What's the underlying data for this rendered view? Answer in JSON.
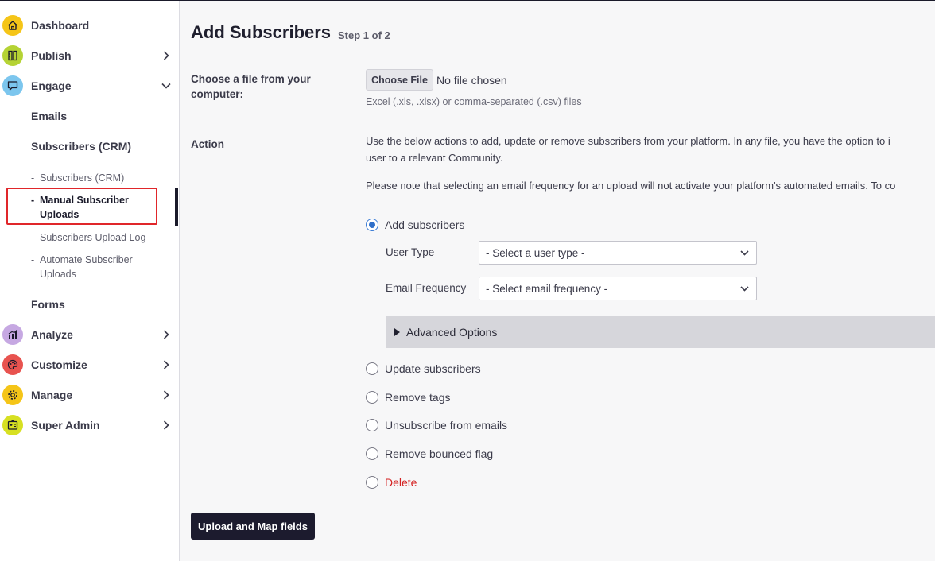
{
  "sidebar": {
    "items": [
      {
        "label": "Dashboard",
        "icon": "home-icon",
        "color": "#f5c518"
      },
      {
        "label": "Publish",
        "icon": "pencil-ruler-icon",
        "color": "#b5d334"
      },
      {
        "label": "Engage",
        "icon": "chat-icon",
        "color": "#7cc6ee"
      },
      {
        "label": "Analyze",
        "icon": "chart-icon",
        "color": "#c6a8e2"
      },
      {
        "label": "Customize",
        "icon": "palette-icon",
        "color": "#e8534f"
      },
      {
        "label": "Manage",
        "icon": "gear-icon",
        "color": "#f5c518"
      },
      {
        "label": "Super Admin",
        "icon": "id-badge-icon",
        "color": "#d7e022"
      }
    ],
    "engage_sub": {
      "emails": "Emails",
      "subscribers": "Subscribers (CRM)",
      "forms": "Forms",
      "subsub": [
        {
          "label": "Subscribers (CRM)"
        },
        {
          "label": "Manual Subscriber Uploads",
          "line1": "Manual Subscriber",
          "line2": "Uploads"
        },
        {
          "label": "Subscribers Upload Log"
        },
        {
          "label": "Automate Subscriber Uploads",
          "line1": "Automate Subscriber",
          "line2": "Uploads"
        }
      ],
      "dash": "-"
    }
  },
  "main": {
    "title": "Add Subscribers",
    "step": "Step 1 of 2",
    "file": {
      "label": "Choose a file from your computer:",
      "button": "Choose File",
      "status": "No file chosen",
      "hint": "Excel (.xls, .xlsx) or comma-separated (.csv) files"
    },
    "action": {
      "label": "Action",
      "para1_line1": "Use the below actions to add, update or remove subscribers from your platform. In any file, you have the option to i",
      "para1_line2": "user to a relevant Community.",
      "para2": "Please note that selecting an email frequency for an upload will not activate your platform's automated emails. To co",
      "options": [
        {
          "label": "Add subscribers",
          "checked": true
        },
        {
          "label": "Update subscribers",
          "checked": false
        },
        {
          "label": "Remove tags",
          "checked": false
        },
        {
          "label": "Unsubscribe from emails",
          "checked": false
        },
        {
          "label": "Remove bounced flag",
          "checked": false
        },
        {
          "label": "Delete",
          "checked": false
        }
      ],
      "user_type": {
        "label": "User Type",
        "value": "- Select a user type -"
      },
      "email_frequency": {
        "label": "Email Frequency",
        "value": "- Select email frequency -"
      },
      "advanced": "Advanced Options"
    },
    "submit": "Upload and Map fields"
  },
  "colors": {
    "accent": "#2f6fc9",
    "danger": "#d42020",
    "primary_button": "#1c1b2e",
    "highlight": "#e0262a"
  }
}
